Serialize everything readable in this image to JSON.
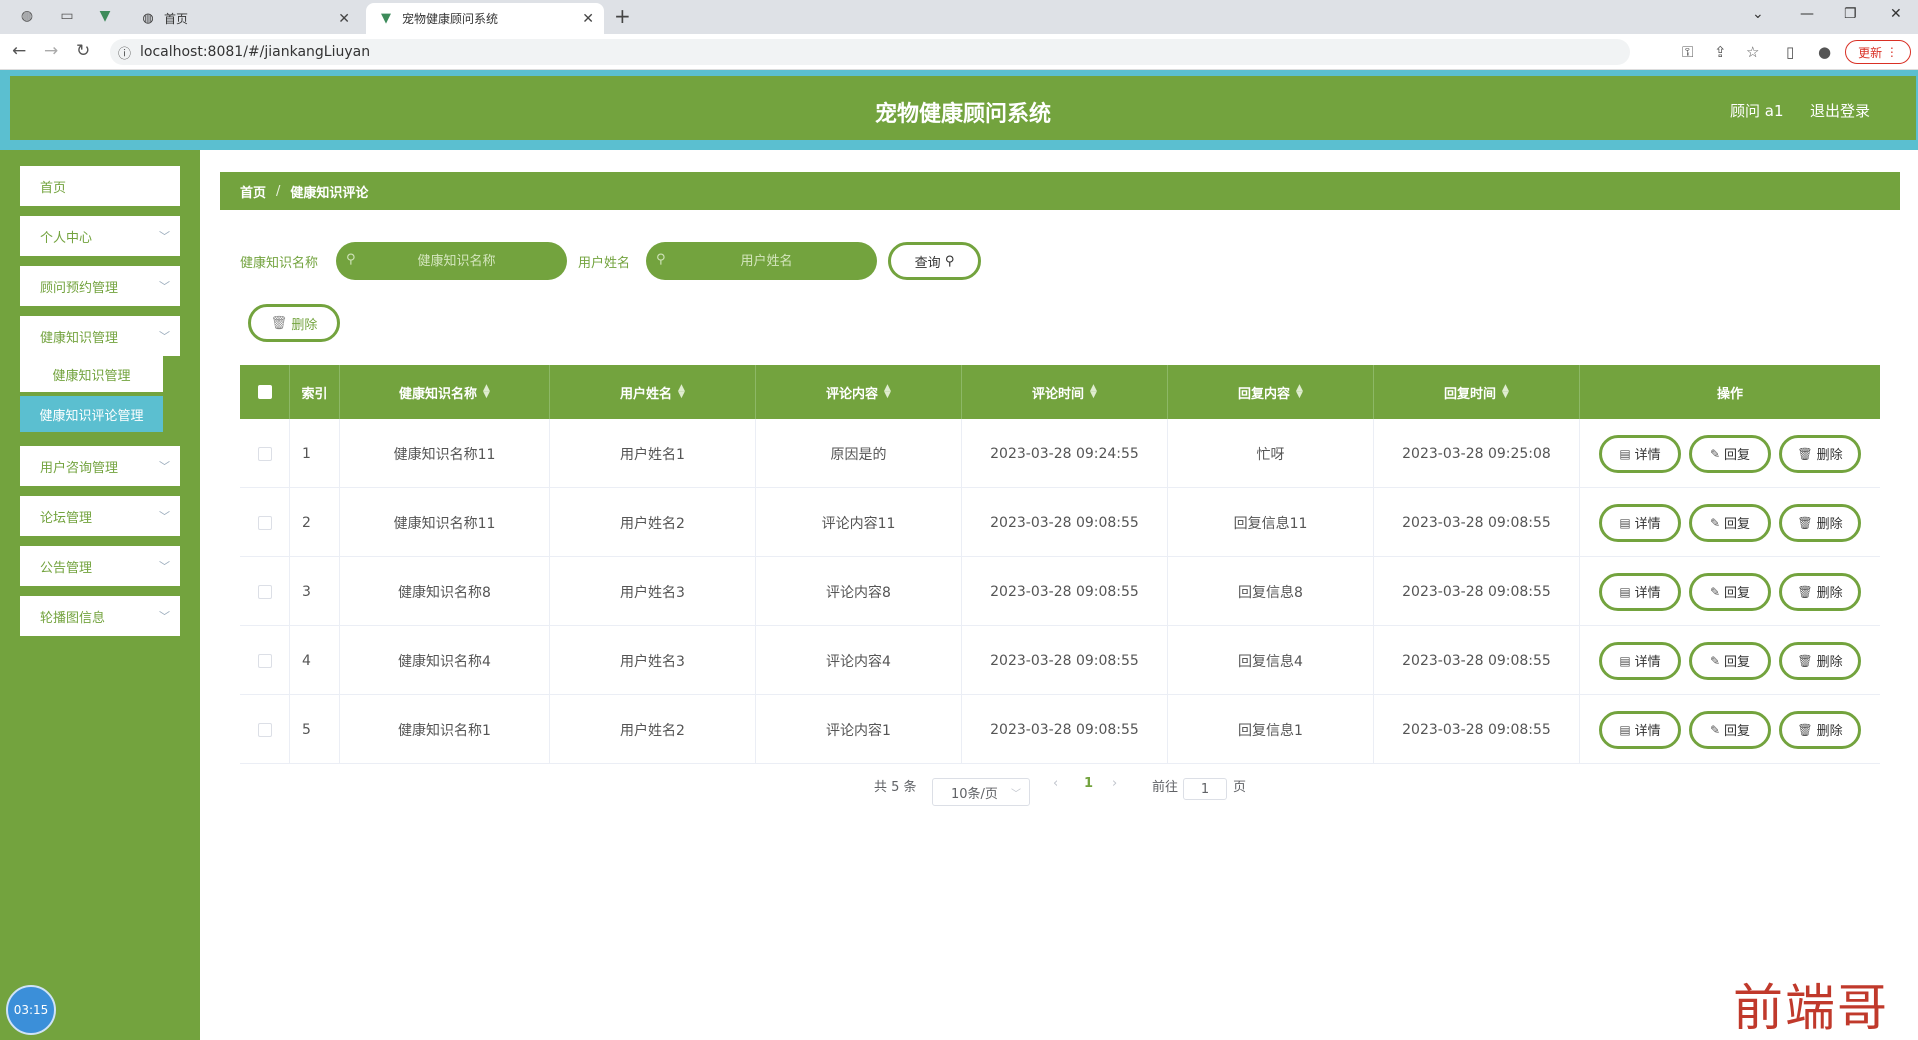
{
  "browser": {
    "tabs": [
      {
        "title": "首页",
        "active": false
      },
      {
        "title": "宠物健康顾问系统",
        "active": true
      }
    ],
    "url": "localhost:8081/#/jiankangLiuyan",
    "update_label": "更新"
  },
  "header": {
    "title": "宠物健康顾问系统",
    "user": "顾问 a1",
    "logout": "退出登录"
  },
  "sidebar": {
    "items": [
      {
        "label": "首页"
      },
      {
        "label": "个人中心"
      },
      {
        "label": "顾问预约管理"
      },
      {
        "label": "健康知识管理"
      },
      {
        "label": "用户咨询管理"
      },
      {
        "label": "论坛管理"
      },
      {
        "label": "公告管理"
      },
      {
        "label": "轮播图信息"
      }
    ],
    "submenu": [
      {
        "label": "健康知识管理",
        "active": false
      },
      {
        "label": "健康知识评论管理",
        "active": true
      }
    ],
    "clock": "03:15"
  },
  "breadcrumb": {
    "home": "首页",
    "current": "健康知识评论"
  },
  "search": {
    "field1_label": "健康知识名称",
    "field1_placeholder": "健康知识名称",
    "field2_label": "用户姓名",
    "field2_placeholder": "用户姓名",
    "query_label": "查询"
  },
  "toolbar": {
    "delete_label": "删除"
  },
  "table": {
    "headers": [
      "索引",
      "健康知识名称",
      "用户姓名",
      "评论内容",
      "评论时间",
      "回复内容",
      "回复时间",
      "操作"
    ],
    "rows": [
      {
        "index": "1",
        "name": "健康知识名称11",
        "user": "用户姓名1",
        "comment": "原因是的",
        "comment_time": "2023-03-28 09:24:55",
        "reply": "忙呀",
        "reply_time": "2023-03-28 09:25:08"
      },
      {
        "index": "2",
        "name": "健康知识名称11",
        "user": "用户姓名2",
        "comment": "评论内容11",
        "comment_time": "2023-03-28 09:08:55",
        "reply": "回复信息11",
        "reply_time": "2023-03-28 09:08:55"
      },
      {
        "index": "3",
        "name": "健康知识名称8",
        "user": "用户姓名3",
        "comment": "评论内容8",
        "comment_time": "2023-03-28 09:08:55",
        "reply": "回复信息8",
        "reply_time": "2023-03-28 09:08:55"
      },
      {
        "index": "4",
        "name": "健康知识名称4",
        "user": "用户姓名3",
        "comment": "评论内容4",
        "comment_time": "2023-03-28 09:08:55",
        "reply": "回复信息4",
        "reply_time": "2023-03-28 09:08:55"
      },
      {
        "index": "5",
        "name": "健康知识名称1",
        "user": "用户姓名2",
        "comment": "评论内容1",
        "comment_time": "2023-03-28 09:08:55",
        "reply": "回复信息1",
        "reply_time": "2023-03-28 09:08:55"
      }
    ],
    "actions": {
      "detail": "详情",
      "reply": "回复",
      "delete": "删除"
    }
  },
  "pagination": {
    "total": "共 5 条",
    "page_size": "10条/页",
    "current_page": "1",
    "goto_prefix": "前往",
    "goto_value": "1",
    "goto_suffix": "页"
  },
  "watermark": "前端哥",
  "colors": {
    "primary": "#73a33e",
    "accent_strip": "#5bbfd0",
    "submenu_active": "#5bbfd0"
  }
}
